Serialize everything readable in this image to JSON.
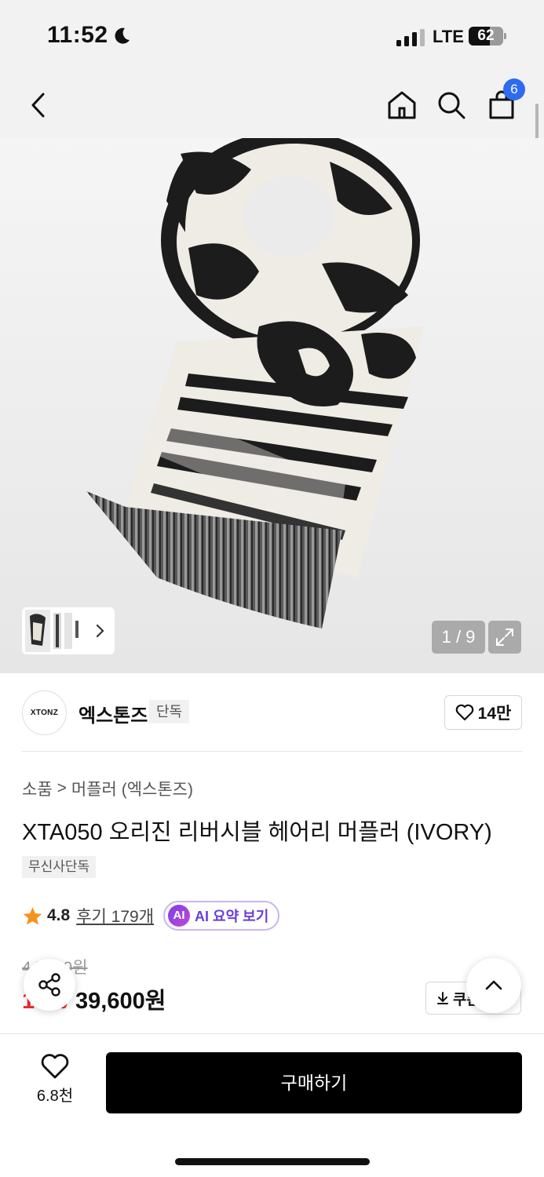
{
  "status_bar": {
    "time": "11:52",
    "network": "LTE",
    "battery": "62",
    "battery_level": 0.62
  },
  "nav": {
    "cart_count": "6"
  },
  "gallery": {
    "counter": "1 / 9"
  },
  "brand": {
    "logo_text": "XTONZ",
    "name": "엑스톤즈",
    "tag": "단독",
    "likes": "14만"
  },
  "breadcrumb": {
    "category": "소품",
    "separator": ">",
    "subcategory": "머플러 (엑스톤즈)"
  },
  "product": {
    "title": "XTA050 오리진 리버시블 헤어리 머플러 (IVORY)",
    "tag": "무신사단독"
  },
  "rating": {
    "score": "4.8",
    "reviews": "후기 179개",
    "ai_badge": "AI",
    "ai_label": "AI 요약 보기"
  },
  "price": {
    "original": "44,000원",
    "discount": "10%",
    "sale": "39,600원",
    "coupon_label": "쿠폰"
  },
  "bottom": {
    "wish_count": "6.8천",
    "buy_label": "구매하기"
  },
  "colors": {
    "accent_blue": "#2e6bf0",
    "discount_red": "#f02b2b",
    "ai_purple": "#6b3ed6"
  }
}
